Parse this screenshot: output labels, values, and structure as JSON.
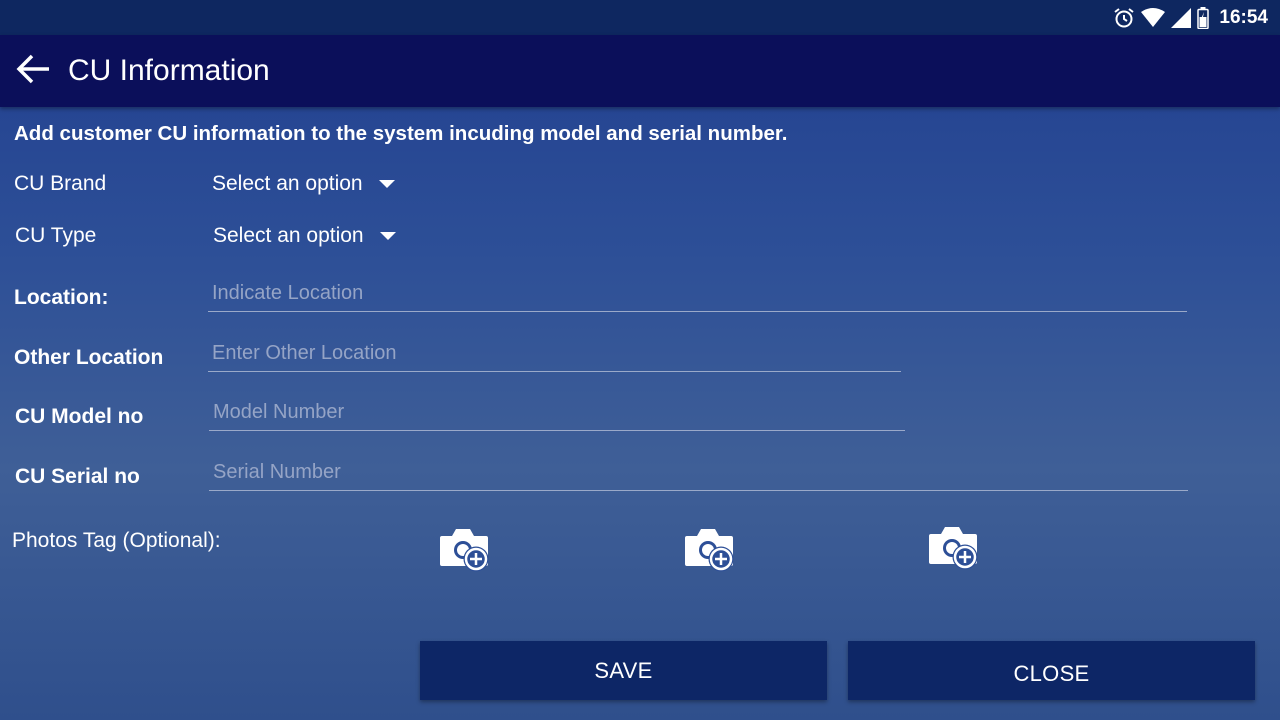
{
  "status_bar": {
    "time": "16:54",
    "icons": [
      "alarm-icon",
      "wifi-icon",
      "signal-icon",
      "battery-icon"
    ]
  },
  "app_bar": {
    "title": "CU Information",
    "back_icon": "arrow-left-icon"
  },
  "form": {
    "description": "Add customer CU information to the system incuding model and serial number.",
    "cu_brand": {
      "label": "CU Brand",
      "value": "Select an option"
    },
    "cu_type": {
      "label": "CU Type",
      "value": "Select an option"
    },
    "location": {
      "label": "Location:",
      "placeholder": "Indicate Location"
    },
    "other_location": {
      "label": "Other Location",
      "placeholder": "Enter Other Location"
    },
    "model_no": {
      "label": "CU Model no",
      "placeholder": "Model Number"
    },
    "serial_no": {
      "label": "CU Serial no",
      "placeholder": "Serial Number"
    },
    "photos": {
      "label": "Photos Tag (Optional):",
      "icon": "add-photo-camera-icon"
    }
  },
  "actions": {
    "save_label": "SAVE",
    "close_label": "CLOSE"
  },
  "colors": {
    "status_bar": "#0e2760",
    "app_bar": "#0b0f5a",
    "button": "#0d2666",
    "background_top": "#213f8f",
    "background_bottom": "#2f4f8c"
  }
}
